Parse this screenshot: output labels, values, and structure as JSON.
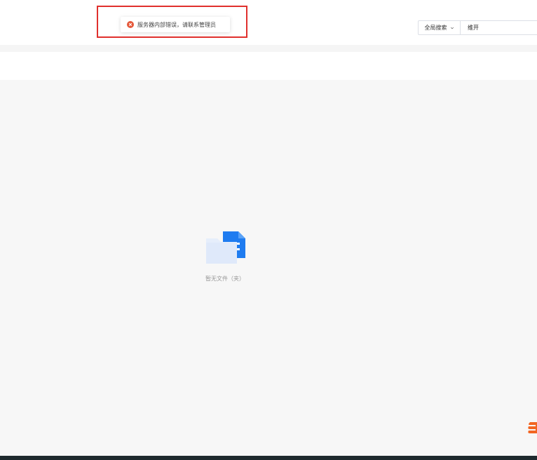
{
  "toast": {
    "message": "服务器内部错误，请联系管理员",
    "icon": "error-circle-icon",
    "color": "#e5583a"
  },
  "search": {
    "scope_label": "全局搜索",
    "query": "维开"
  },
  "empty_state": {
    "icon": "folder-file-icon",
    "text": "暂无文件（夹）"
  },
  "colors": {
    "highlight": "#e0302d",
    "folder_back": "#1f7cf0",
    "folder_front": "#e6eefb",
    "badge": "#f26522"
  }
}
